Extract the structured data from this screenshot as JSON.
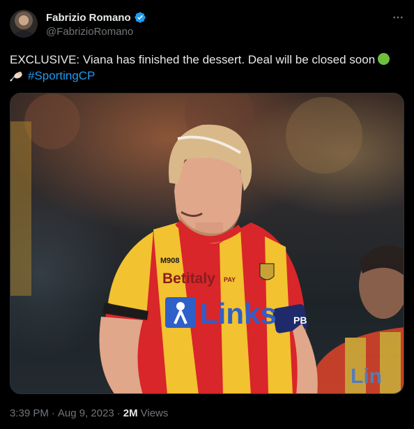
{
  "author": {
    "display_name": "Fabrizio Romano",
    "handle": "@FabrizioRomano"
  },
  "icons": {
    "verified": "verified-badge-icon",
    "more": "more-options-icon",
    "writing": "writing-hand-icon",
    "green_circle": "green-circle-emoji"
  },
  "tweet": {
    "text_line1": "EXCLUSIVE: Viana has finished the dessert. Deal will be closed soon",
    "hashtag": "#SportingCP"
  },
  "media": {
    "jersey_sponsor_main": "Links",
    "jersey_sponsor_secondary": "Betitaly",
    "jersey_sponsor_secondary_tag": "PAY",
    "jersey_kit_maker": "M908",
    "armband_text": "PB"
  },
  "meta": {
    "time": "3:39 PM",
    "date": "Aug 9, 2023",
    "views_count": "2M",
    "views_label": "Views"
  },
  "colors": {
    "background": "#000000",
    "text_primary": "#e7e9ea",
    "text_secondary": "#71767b",
    "link": "#1d9bf0",
    "verified": "#1d9bf0",
    "jersey_red": "#d8262a",
    "jersey_yellow": "#f2c230"
  }
}
